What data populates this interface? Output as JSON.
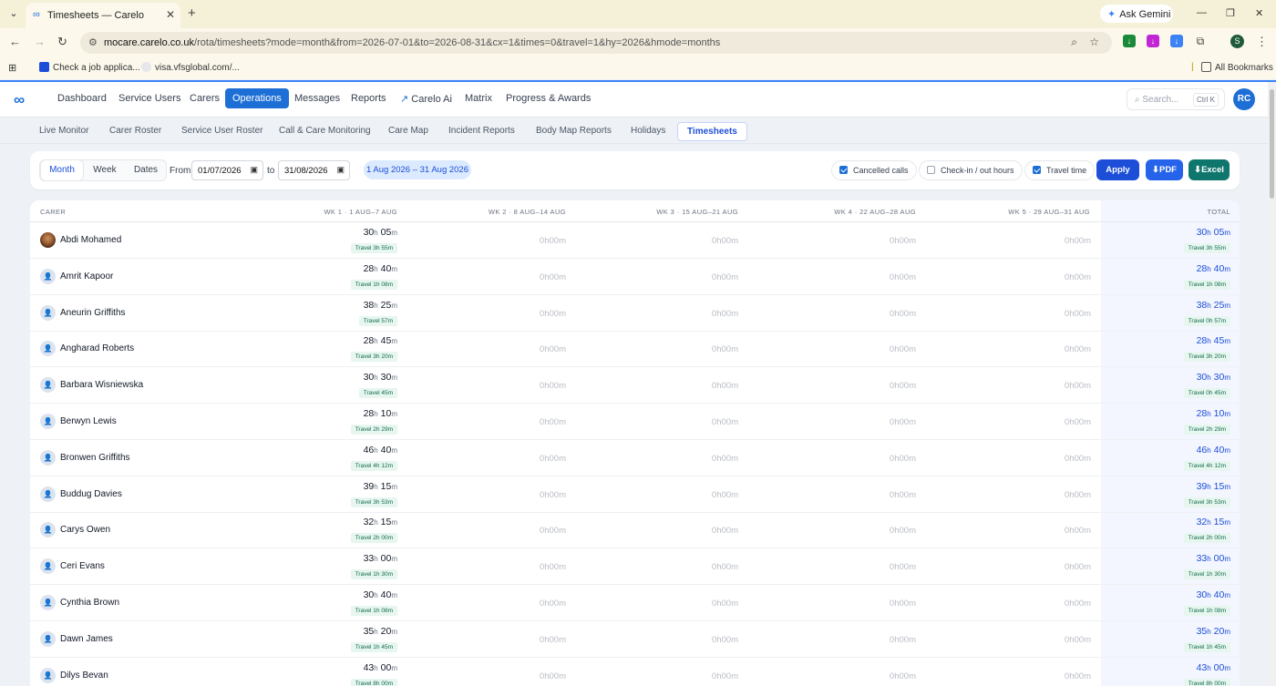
{
  "browser": {
    "tab_title": "Timesheets — Carelo",
    "ask_gemini": "Ask Gemini",
    "url_host": "mocare.carelo.co.uk",
    "url_path": "/rota/timesheets?mode=month&from=2026-07-01&to=2026-08-31&cx=1&times=0&travel=1&hy=2026&hmode=months",
    "profile_letter": "S",
    "bookmarks": [
      "Check a job applica...",
      "visa.vfsglobal.com/..."
    ],
    "all_bookmarks": "All Bookmarks"
  },
  "nav": {
    "items": [
      "Dashboard",
      "Service Users",
      "Carers",
      "Operations",
      "Messages",
      "Reports",
      "Carelo Ai",
      "Matrix",
      "Progress & Awards"
    ],
    "active": "Operations",
    "search_placeholder": "Search...",
    "search_shortcut": "Ctrl K",
    "user_initials": "RC"
  },
  "subnav": {
    "items": [
      "Live Monitor",
      "Carer Roster",
      "Service User Roster",
      "Call & Care Monitoring",
      "Care Map",
      "Incident Reports",
      "Body Map Reports",
      "Holidays",
      "Timesheets"
    ],
    "active": "Timesheets"
  },
  "filters": {
    "modes": [
      "Month",
      "Week",
      "Dates"
    ],
    "active_mode": "Month",
    "from_label": "From",
    "from_value": "01/07/2026",
    "to_label": "to",
    "to_value": "31/08/2026",
    "range_label": "1 Aug 2026 – 31 Aug 2026",
    "cancelled_calls": {
      "label": "Cancelled calls",
      "checked": true
    },
    "checkin_hours": {
      "label": "Check-in / out hours",
      "checked": false
    },
    "travel_time": {
      "label": "Travel time",
      "checked": true
    },
    "apply": "Apply",
    "pdf": "PDF",
    "excel": "Excel"
  },
  "table": {
    "headers": [
      "CARER",
      "WK 1 · 1 AUG–7 AUG",
      "WK 2 · 8 AUG–14 AUG",
      "WK 3 · 15 AUG–21 AUG",
      "WK 4 · 22 AUG–28 AUG",
      "WK 5 · 29 AUG–31 AUG",
      "TOTAL"
    ],
    "zero_h": "0",
    "zero_m": "00",
    "h_unit": "h",
    "m_unit": "m",
    "rows": [
      {
        "name": "Abdi Mohamed",
        "h": "30",
        "m": "05",
        "travel": "Travel 3h 55m",
        "total_travel": "Travel 3h 55m"
      },
      {
        "name": "Amrit Kapoor",
        "h": "28",
        "m": "40",
        "travel": "Travel 1h 08m",
        "total_travel": "Travel 1h 08m"
      },
      {
        "name": "Aneurin Griffiths",
        "h": "38",
        "m": "25",
        "travel": "Travel 57m",
        "total_travel": "Travel 0h 57m"
      },
      {
        "name": "Angharad Roberts",
        "h": "28",
        "m": "45",
        "travel": "Travel 3h 20m",
        "total_travel": "Travel 3h 20m"
      },
      {
        "name": "Barbara Wisniewska",
        "h": "30",
        "m": "30",
        "travel": "Travel 45m",
        "total_travel": "Travel 0h 45m"
      },
      {
        "name": "Berwyn Lewis",
        "h": "28",
        "m": "10",
        "travel": "Travel 2h 29m",
        "total_travel": "Travel 2h 29m"
      },
      {
        "name": "Bronwen Griffiths",
        "h": "46",
        "m": "40",
        "travel": "Travel 4h 12m",
        "total_travel": "Travel 4h 12m"
      },
      {
        "name": "Buddug Davies",
        "h": "39",
        "m": "15",
        "travel": "Travel 3h 53m",
        "total_travel": "Travel 3h 53m"
      },
      {
        "name": "Carys Owen",
        "h": "32",
        "m": "15",
        "travel": "Travel 2h 00m",
        "total_travel": "Travel 2h 00m"
      },
      {
        "name": "Ceri Evans",
        "h": "33",
        "m": "00",
        "travel": "Travel 1h 30m",
        "total_travel": "Travel 1h 30m"
      },
      {
        "name": "Cynthia Brown",
        "h": "30",
        "m": "40",
        "travel": "Travel 1h 08m",
        "total_travel": "Travel 1h 08m"
      },
      {
        "name": "Dawn James",
        "h": "35",
        "m": "20",
        "travel": "Travel 1h 45m",
        "total_travel": "Travel 1h 45m"
      },
      {
        "name": "Dilys Bevan",
        "h": "43",
        "m": "00",
        "travel": "Travel 8h 00m",
        "total_travel": "Travel 8h 00m"
      }
    ]
  },
  "colors": {
    "accent": "#1d6fd6",
    "total_bg": "#f3f6fe",
    "travel_badge": "#e7f6ef"
  }
}
